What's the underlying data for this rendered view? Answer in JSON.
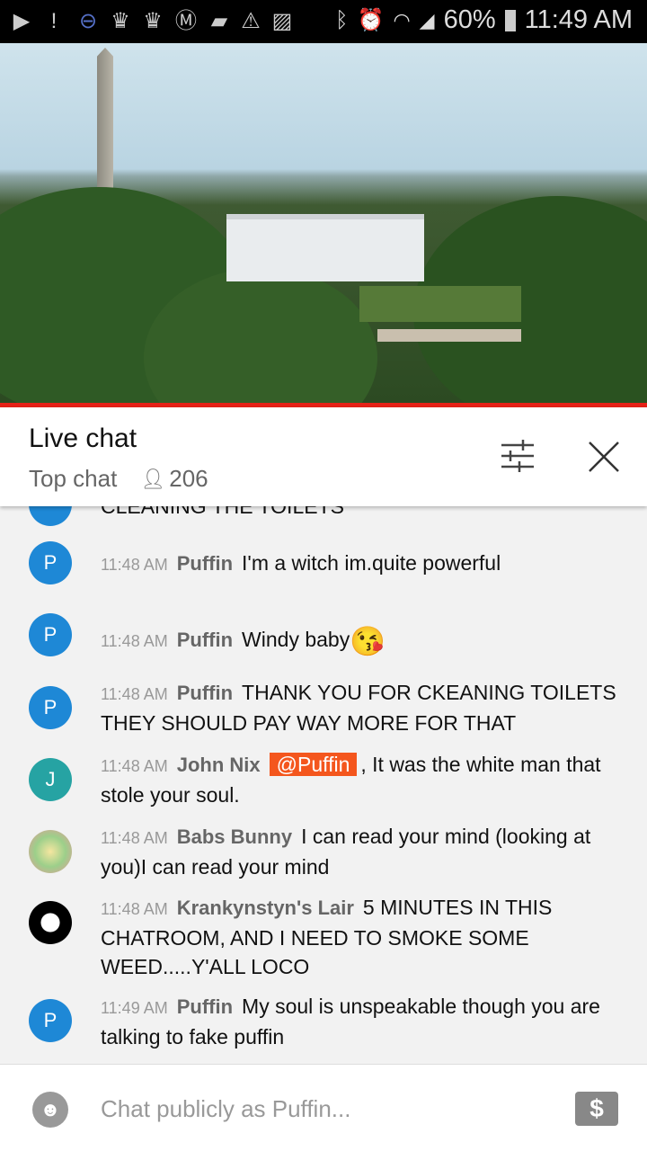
{
  "status_bar": {
    "battery": "60%",
    "time": "11:49 AM",
    "left_icons": [
      "youtube-icon",
      "message-alert-icon",
      "pokeball-icon",
      "crown-icon",
      "crown-icon",
      "m-app-icon",
      "folder-icon",
      "warning-icon",
      "image-icon"
    ],
    "right_icons": [
      "bluetooth-icon",
      "alarm-icon",
      "wifi-icon",
      "signal-icon",
      "battery-icon"
    ]
  },
  "header": {
    "title": "Live chat",
    "mode": "Top chat",
    "viewers": "206"
  },
  "colors": {
    "accent": "#e62117",
    "mention": "#f4561d",
    "avatar_p": "#1e88d6",
    "avatar_j": "#26a3a3"
  },
  "partial_message": "CLEANING THE TOILETS",
  "messages": [
    {
      "avatar": "P",
      "time": "11:48 AM",
      "author": "Puffin",
      "text": "I'm a witch im.quite powerful"
    },
    {
      "avatar": "P",
      "time": "11:48 AM",
      "author": "Puffin",
      "text": "Windy baby",
      "emoji": "😘"
    },
    {
      "avatar": "P",
      "time": "11:48 AM",
      "author": "Puffin",
      "text": "THANK YOU FOR CKEANING TOILETS THEY SHOULD PAY WAY MORE FOR THAT"
    },
    {
      "avatar": "J",
      "time": "11:48 AM",
      "author": "John Nix",
      "mention": "@Puffin",
      "text": ", It was the white man that stole your soul."
    },
    {
      "avatar": "",
      "time": "11:48 AM",
      "author": "Babs Bunny",
      "text": "I can read your mind (looking at you)I can read your mind"
    },
    {
      "avatar": "",
      "time": "11:48 AM",
      "author": "Krankynstyn's Lair",
      "text": "5 MINUTES IN THIS CHATROOM, AND I NEED TO SMOKE SOME WEED.....Y'ALL LOCO"
    },
    {
      "avatar": "P",
      "time": "11:49 AM",
      "author": "Puffin",
      "text": "My soul is unspeakable though you are talking to fake puffin"
    }
  ],
  "input": {
    "placeholder": "Chat publicly as Puffin..."
  }
}
